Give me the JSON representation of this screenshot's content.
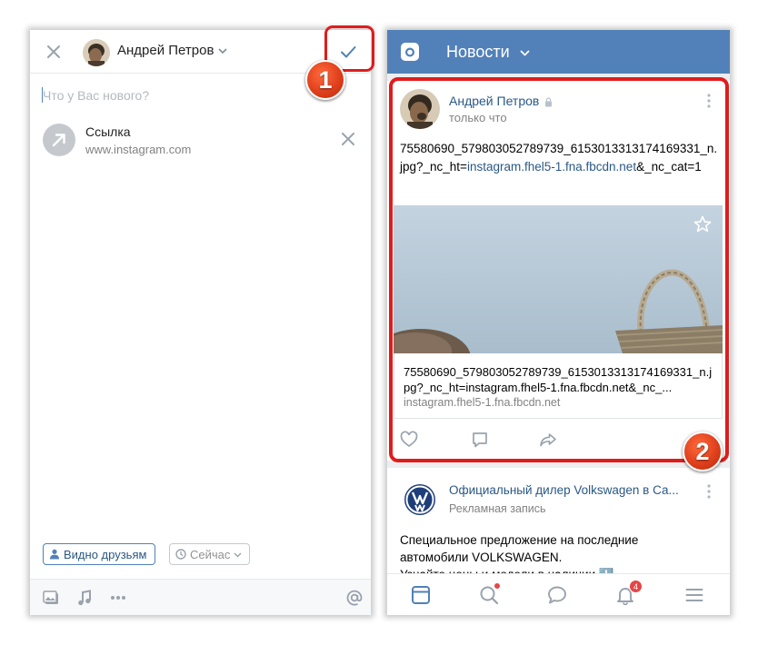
{
  "editor": {
    "author": "Андрей Петров",
    "placeholder": "Что у Вас нового?",
    "attachment": {
      "title": "Ссылка",
      "url": "www.instagram.com"
    },
    "visibility_label": "Видно друзьям",
    "time_label": "Сейчас",
    "toolbar_icons": [
      "photo-icon",
      "music-icon",
      "more-icon",
      "mention-icon"
    ]
  },
  "feed": {
    "title": "Новости",
    "post": {
      "author": "Андрей Петров",
      "time": "только что",
      "text_before_link": "75580690_579803052789739_6153013313174169331_n.jpg?_nc_ht=",
      "text_link": "instagram.fhel5-1.fna.fbcdn.net",
      "text_after_link": "&_nc_cat=1",
      "snippet_title": "75580690_579803052789739_6153013313174169331_n.jpg?_nc_ht=instagram.fhel5-1.fna.fbcdn.net&_nc_...",
      "snippet_url": "instagram.fhel5-1.fna.fbcdn.net"
    },
    "ad": {
      "name": "Официальный дилер Volkswagen в Са...",
      "tag": "Рекламная запись",
      "text_line1": "Специальное предложение на последние",
      "text_line2": "автомобили VOLKSWAGEN.",
      "text_line3": "Узнайте цены и модели в наличии ⬇️"
    },
    "tabbar": {
      "notifications_badge": "4"
    }
  },
  "annotations": {
    "marker1": "1",
    "marker2": "2"
  },
  "colors": {
    "accent": "#5181b8",
    "link": "#2a5885",
    "highlight": "#e01c1c"
  }
}
